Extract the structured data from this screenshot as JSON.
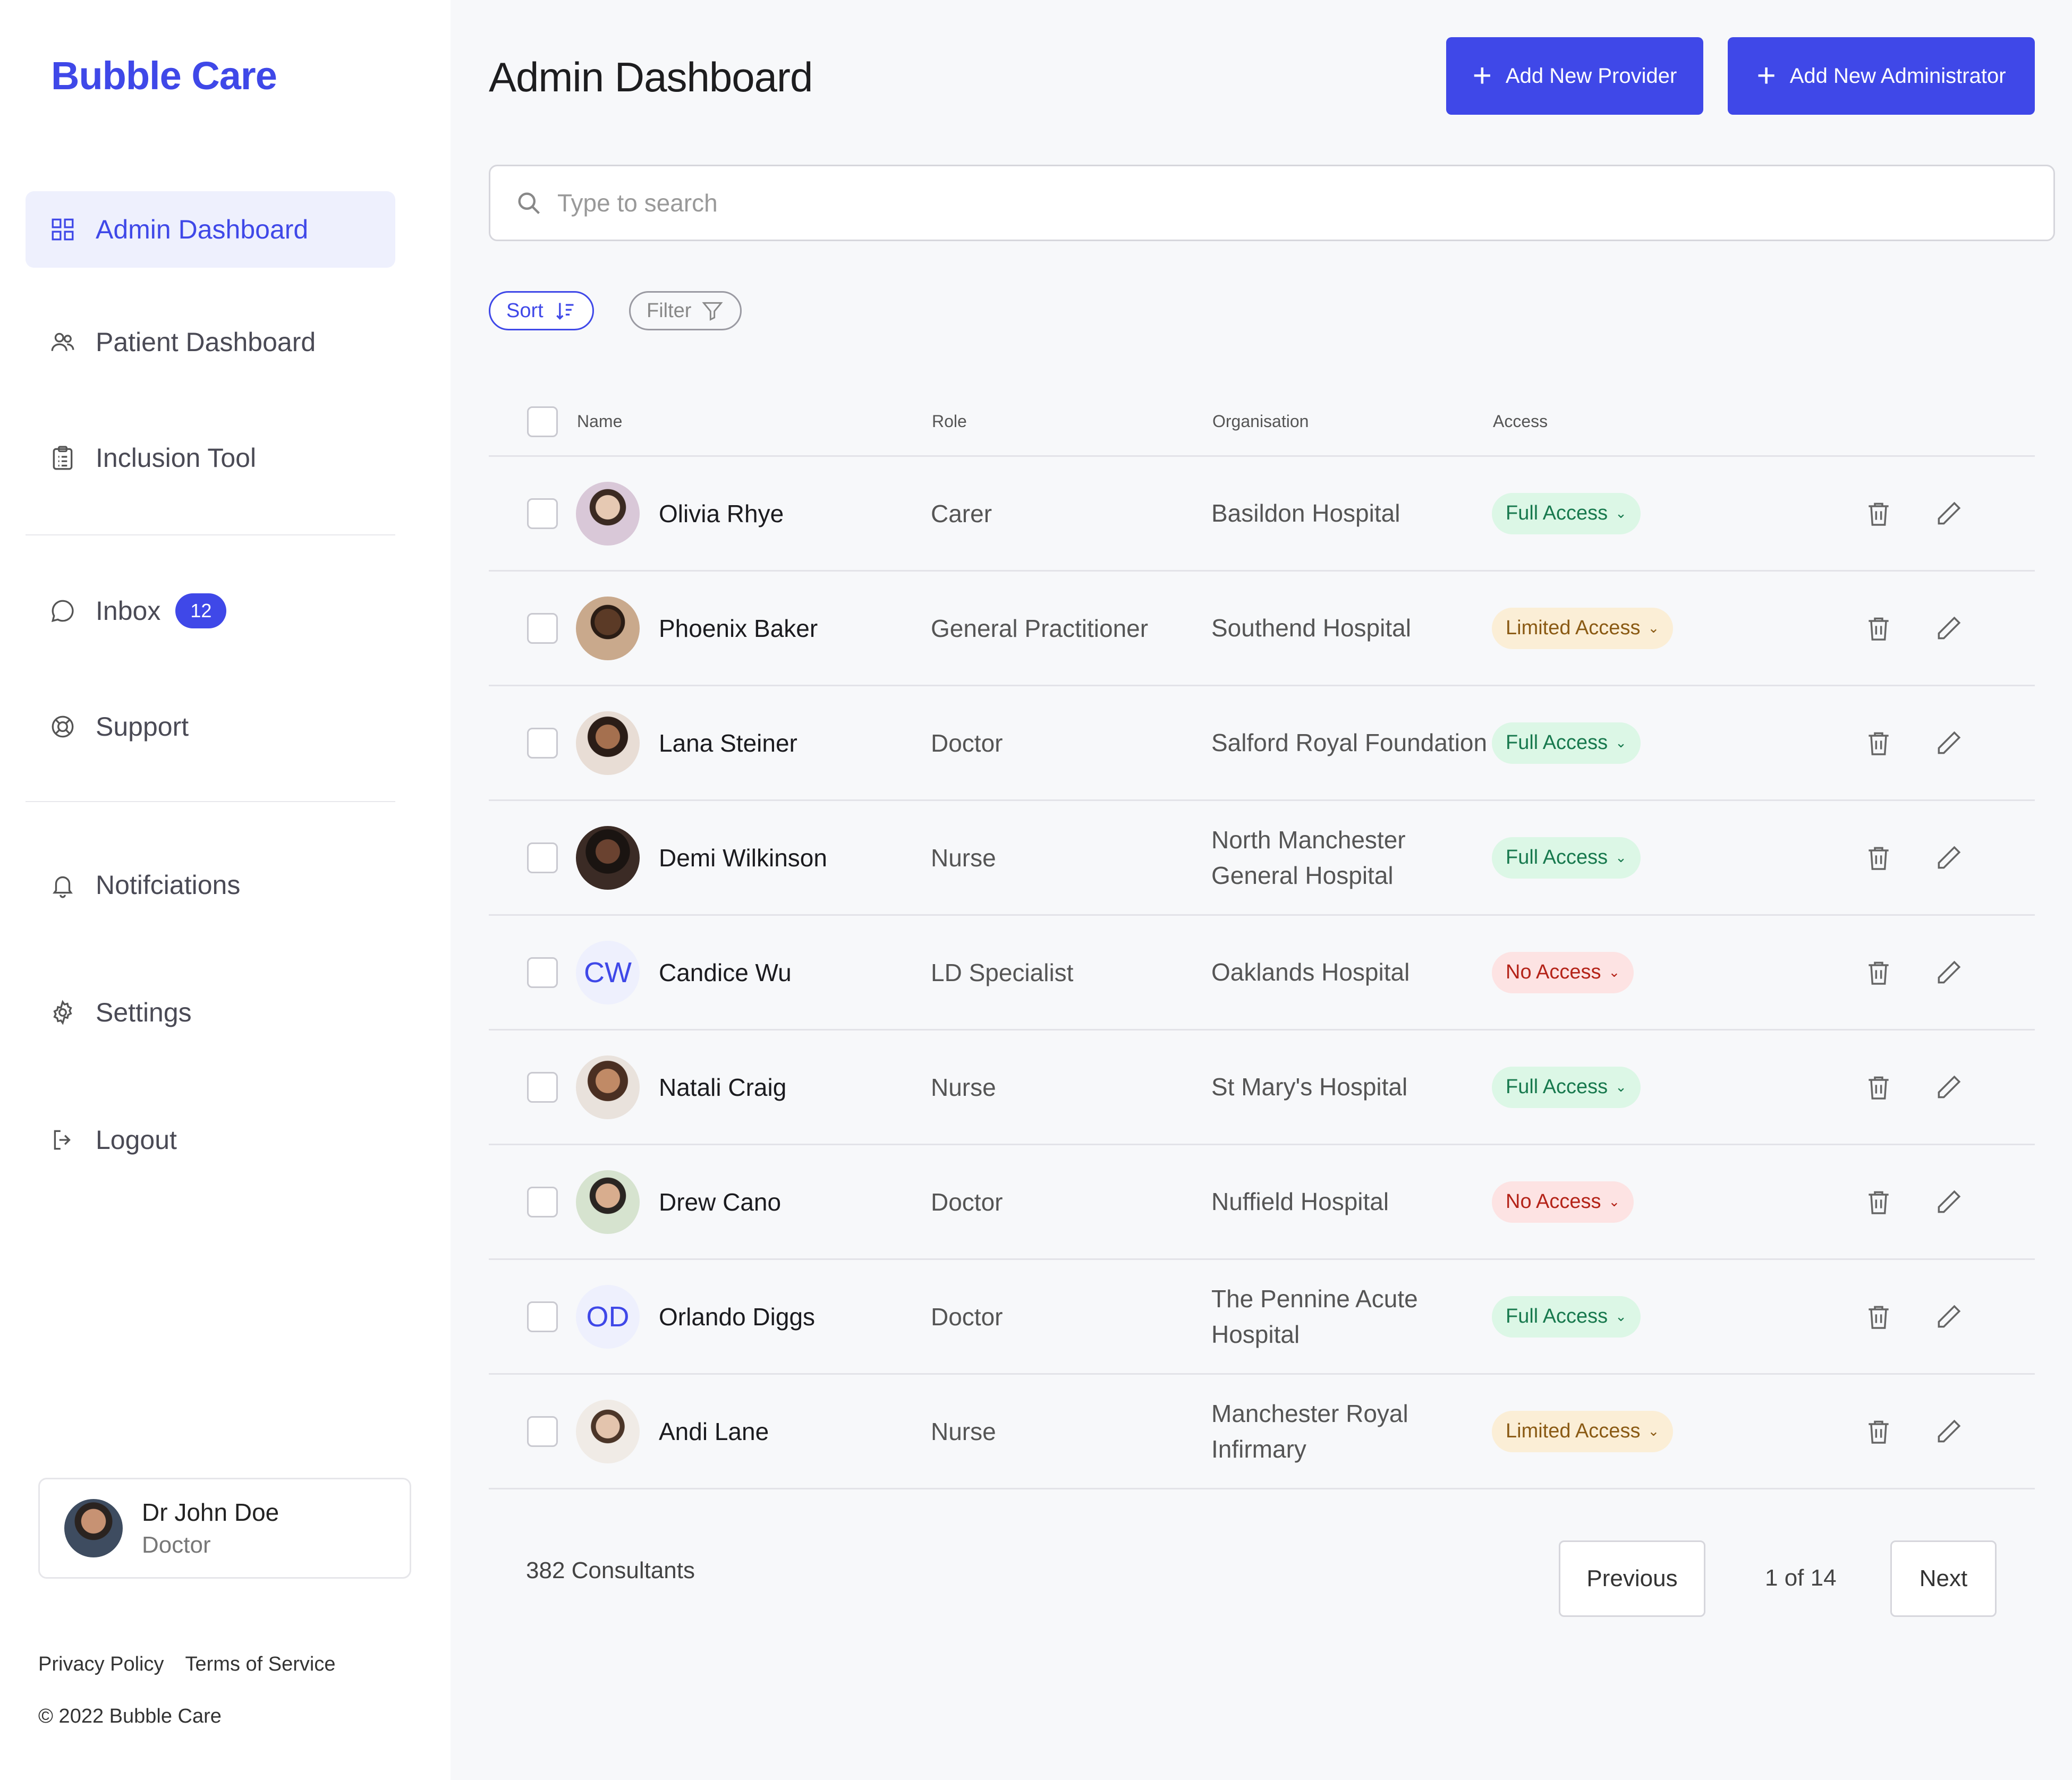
{
  "app": {
    "brand": "Bubble Care",
    "colors": {
      "accent": "#3f48e8"
    }
  },
  "sidebar": {
    "items": [
      {
        "label": "Admin Dashboard",
        "icon": "grid-icon",
        "active": true
      },
      {
        "label": "Patient Dashboard",
        "icon": "users-icon"
      },
      {
        "label": "Inclusion Tool",
        "icon": "clipboard-icon"
      },
      {
        "label": "Inbox",
        "icon": "message-icon",
        "badge": "12"
      },
      {
        "label": "Support",
        "icon": "lifebuoy-icon"
      },
      {
        "label": "Notifciations",
        "icon": "bell-icon"
      },
      {
        "label": "Settings",
        "icon": "gear-icon"
      },
      {
        "label": "Logout",
        "icon": "logout-icon"
      }
    ],
    "profile": {
      "name": "Dr John Doe",
      "role": "Doctor"
    },
    "footer": {
      "privacy": "Privacy Policy",
      "terms": "Terms of Service",
      "copyright": "© 2022 Bubble Care"
    }
  },
  "main": {
    "title": "Admin Dashboard",
    "add_provider": "Add New Provider",
    "add_admin": "Add New Administrator",
    "search_placeholder": "Type to search",
    "sort_label": "Sort",
    "filter_label": "Filter",
    "columns": {
      "name": "Name",
      "role": "Role",
      "organisation": "Organisation",
      "access": "Access"
    },
    "rows": [
      {
        "name": "Olivia Rhye",
        "role": "Carer",
        "org": "Basildon Hospital",
        "access": "Full Access",
        "level": "full"
      },
      {
        "name": "Phoenix Baker",
        "role": "General Practitioner",
        "org": "Southend Hospital",
        "access": "Limited Access",
        "level": "limited"
      },
      {
        "name": "Lana Steiner",
        "role": "Doctor",
        "org": "Salford Royal Foundation",
        "access": "Full Access",
        "level": "full"
      },
      {
        "name": "Demi Wilkinson",
        "role": "Nurse",
        "org": "North Manchester General Hospital",
        "access": "Full Access",
        "level": "full"
      },
      {
        "name": "Candice Wu",
        "initials": "CW",
        "role": "LD Specialist",
        "org": "Oaklands Hospital",
        "access": "No Access",
        "level": "none"
      },
      {
        "name": "Natali Craig",
        "role": "Nurse",
        "org": "St Mary's Hospital",
        "access": "Full Access",
        "level": "full"
      },
      {
        "name": "Drew Cano",
        "role": "Doctor",
        "org": "Nuffield Hospital",
        "access": "No Access",
        "level": "none"
      },
      {
        "name": "Orlando Diggs",
        "initials": "OD",
        "role": "Doctor",
        "org": "The Pennine Acute Hospital",
        "access": "Full Access",
        "level": "full"
      },
      {
        "name": "Andi Lane",
        "role": "Nurse",
        "org": "Manchester Royal Infirmary",
        "access": "Limited Access",
        "level": "limited"
      }
    ],
    "footer": {
      "count": "382 Consultants",
      "previous": "Previous",
      "page": "1 of 14",
      "next": "Next"
    }
  }
}
